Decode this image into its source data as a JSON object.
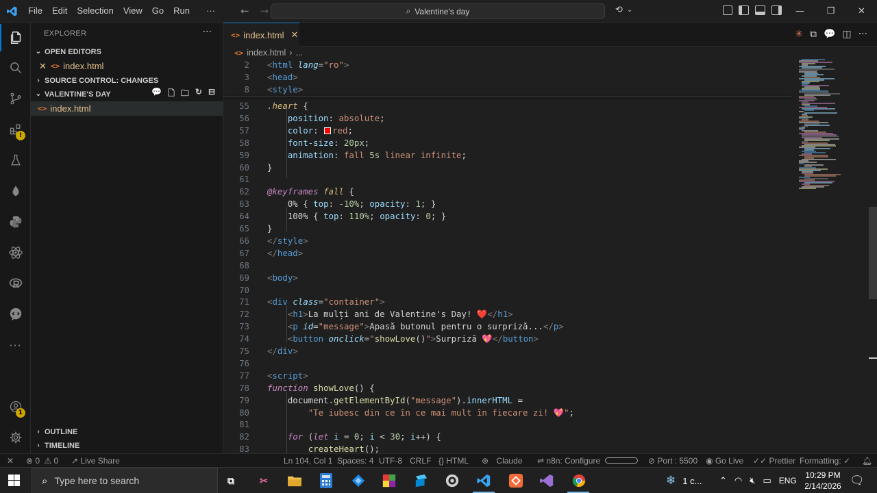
{
  "titlebar": {
    "menus": [
      "File",
      "Edit",
      "Selection",
      "View",
      "Go",
      "Run",
      "···"
    ],
    "search_text": "Valentine's day"
  },
  "activitybar": {
    "icons": [
      "files-icon",
      "search-icon",
      "source-control-icon",
      "extensions-icon",
      "testing-icon",
      "mongodb-icon",
      "python-icon",
      "react-icon",
      "r-icon",
      "chat-icon",
      "more-icon",
      "account-icon",
      "settings-icon"
    ],
    "account_badge": "1"
  },
  "sidebar": {
    "title": "EXPLORER",
    "open_editors_label": "OPEN EDITORS",
    "open_editor_file": "index.html",
    "source_control_label": "SOURCE CONTROL: CHANGES",
    "folder_label": "VALENTINE'S DAY",
    "folder_file": "index.html",
    "outline_label": "OUTLINE",
    "timeline_label": "TIMELINE"
  },
  "tab": {
    "label": "index.html"
  },
  "breadcrumb": {
    "file": "index.html",
    "sep": "›",
    "more": "..."
  },
  "sticky_lines": [
    {
      "n": "2",
      "html": "<span class='t'>&lt;</span><span class='tg'>html</span> <span class='at'>lang</span><span class='pl'>=</span><span class='str'>\"ro\"</span><span class='t'>&gt;</span>"
    },
    {
      "n": "3",
      "html": "<span class='t'>&lt;</span><span class='tg'>head</span><span class='t'>&gt;</span>"
    },
    {
      "n": "8",
      "html": "<span class='t'>&lt;</span><span class='tg'>style</span><span class='t'>&gt;</span>"
    }
  ],
  "code_lines": [
    {
      "n": "55",
      "html": "<span class='sel-c'>.heart</span> <span class='pl'>{</span>"
    },
    {
      "n": "56",
      "html": "    <span class='prop'>position</span><span class='pl'>:</span> <span class='val'>absolute</span><span class='pl'>;</span>"
    },
    {
      "n": "57",
      "html": "    <span class='prop'>color</span><span class='pl'>:</span> <span class='color-box'></span><span class='val'>red</span><span class='pl'>;</span>"
    },
    {
      "n": "58",
      "html": "    <span class='prop'>font-size</span><span class='pl'>:</span> <span class='num'>20px</span><span class='pl'>;</span>"
    },
    {
      "n": "59",
      "html": "    <span class='prop'>animation</span><span class='pl'>:</span> <span class='val'>fall</span> <span class='num'>5s</span> <span class='val'>linear infinite</span><span class='pl'>;</span>"
    },
    {
      "n": "60",
      "html": "<span class='pl'>}</span>"
    },
    {
      "n": "61",
      "html": ""
    },
    {
      "n": "62",
      "html": "<span class='kw'>@keyframes</span> <span class='sel-c'>fall</span> <span class='pl'>{</span>"
    },
    {
      "n": "63",
      "html": "    <span class='txt'>0%</span> <span class='pl'>{</span> <span class='prop'>top</span><span class='pl'>:</span> <span class='num'>-10%</span><span class='pl'>;</span> <span class='prop'>opacity</span><span class='pl'>:</span> <span class='num'>1</span><span class='pl'>;</span> <span class='pl'>}</span>"
    },
    {
      "n": "64",
      "html": "    <span class='txt'>100%</span> <span class='pl'>{</span> <span class='prop'>top</span><span class='pl'>:</span> <span class='num'>110%</span><span class='pl'>;</span> <span class='prop'>opacity</span><span class='pl'>:</span> <span class='num'>0</span><span class='pl'>;</span> <span class='pl'>}</span>"
    },
    {
      "n": "65",
      "html": "<span class='pl'>}</span>"
    },
    {
      "n": "66",
      "html": "<span class='t'>&lt;/</span><span class='tg'>style</span><span class='t'>&gt;</span>"
    },
    {
      "n": "67",
      "html": "<span class='t'>&lt;/</span><span class='tg'>head</span><span class='t'>&gt;</span>"
    },
    {
      "n": "68",
      "html": ""
    },
    {
      "n": "69",
      "html": "<span class='t'>&lt;</span><span class='tg'>body</span><span class='t'>&gt;</span>"
    },
    {
      "n": "70",
      "html": ""
    },
    {
      "n": "71",
      "html": "<span class='t'>&lt;</span><span class='tg'>div</span> <span class='at'>class</span><span class='pl'>=</span><span class='str'>\"container\"</span><span class='t'>&gt;</span>"
    },
    {
      "n": "72",
      "html": "    <span class='t'>&lt;</span><span class='tg'>h1</span><span class='t'>&gt;</span><span class='txt'>La mulți ani de Valentine's Day! ❤️</span><span class='t'>&lt;/</span><span class='tg'>h1</span><span class='t'>&gt;</span>"
    },
    {
      "n": "73",
      "html": "    <span class='t'>&lt;</span><span class='tg'>p</span> <span class='at'>id</span><span class='pl'>=</span><span class='str'>\"message\"</span><span class='t'>&gt;</span><span class='txt'>Apasă butonul pentru o surpriză...</span><span class='t'>&lt;/</span><span class='tg'>p</span><span class='t'>&gt;</span>"
    },
    {
      "n": "74",
      "html": "    <span class='t'>&lt;</span><span class='tg'>button</span> <span class='at'>onclick</span><span class='pl'>=</span><span class='str'>\"</span><span class='fn'>showLove</span><span class='pl'>()</span><span class='str'>\"</span><span class='t'>&gt;</span><span class='txt'>Surpriză 💖</span><span class='t'>&lt;/</span><span class='tg'>button</span><span class='t'>&gt;</span>"
    },
    {
      "n": "75",
      "html": "<span class='t'>&lt;/</span><span class='tg'>div</span><span class='t'>&gt;</span>"
    },
    {
      "n": "76",
      "html": ""
    },
    {
      "n": "77",
      "html": "<span class='t'>&lt;</span><span class='tg'>script</span><span class='t'>&gt;</span>"
    },
    {
      "n": "78",
      "html": "<span class='kw'>function</span> <span class='fn'>showLove</span><span class='pl'>() {</span>"
    },
    {
      "n": "79",
      "html": "    <span class='txt'>document</span><span class='pl'>.</span><span class='fn'>getElementById</span><span class='pl'>(</span><span class='str'>\"message\"</span><span class='pl'>).</span><span class='prop'>innerHTML</span> <span class='pl'>=</span>"
    },
    {
      "n": "80",
      "html": "        <span class='str'>\"Te iubesc din ce în ce mai mult în fiecare zi! 💖\"</span><span class='pl'>;</span>"
    },
    {
      "n": "81",
      "html": ""
    },
    {
      "n": "82",
      "html": "    <span class='kw'>for</span> <span class='pl'>(</span><span class='kw'>let</span> <span class='prop'>i</span> <span class='pl'>=</span> <span class='num'>0</span><span class='pl'>;</span> <span class='prop'>i</span> <span class='pl'>&lt;</span> <span class='num'>30</span><span class='pl'>;</span> <span class='prop'>i</span><span class='pl'>++) {</span>"
    },
    {
      "n": "83",
      "html": "        <span class='fn'>createHeart</span><span class='pl'>();</span>"
    }
  ],
  "statusbar": {
    "errors": "0",
    "warnings": "0",
    "live_share": "Live Share",
    "position": "Ln 104, Col 1",
    "spaces": "Spaces: 4",
    "encoding": "UTF-8",
    "eol": "CRLF",
    "language": "HTML",
    "claude": "Claude",
    "n8n": "n8n: Configure",
    "port": "Port : 5500",
    "go_live": "Go Live",
    "prettier": "Prettier",
    "formatting": "Formatting: ✓"
  },
  "taskbar": {
    "search_placeholder": "Type here to search",
    "weather": "1 c...",
    "language": "ENG",
    "time": "10:29 PM",
    "date": "2/14/2026"
  },
  "colors": {
    "accent": "#0078d4",
    "modified_file": "#e2c08d",
    "html_icon": "#e37933"
  }
}
